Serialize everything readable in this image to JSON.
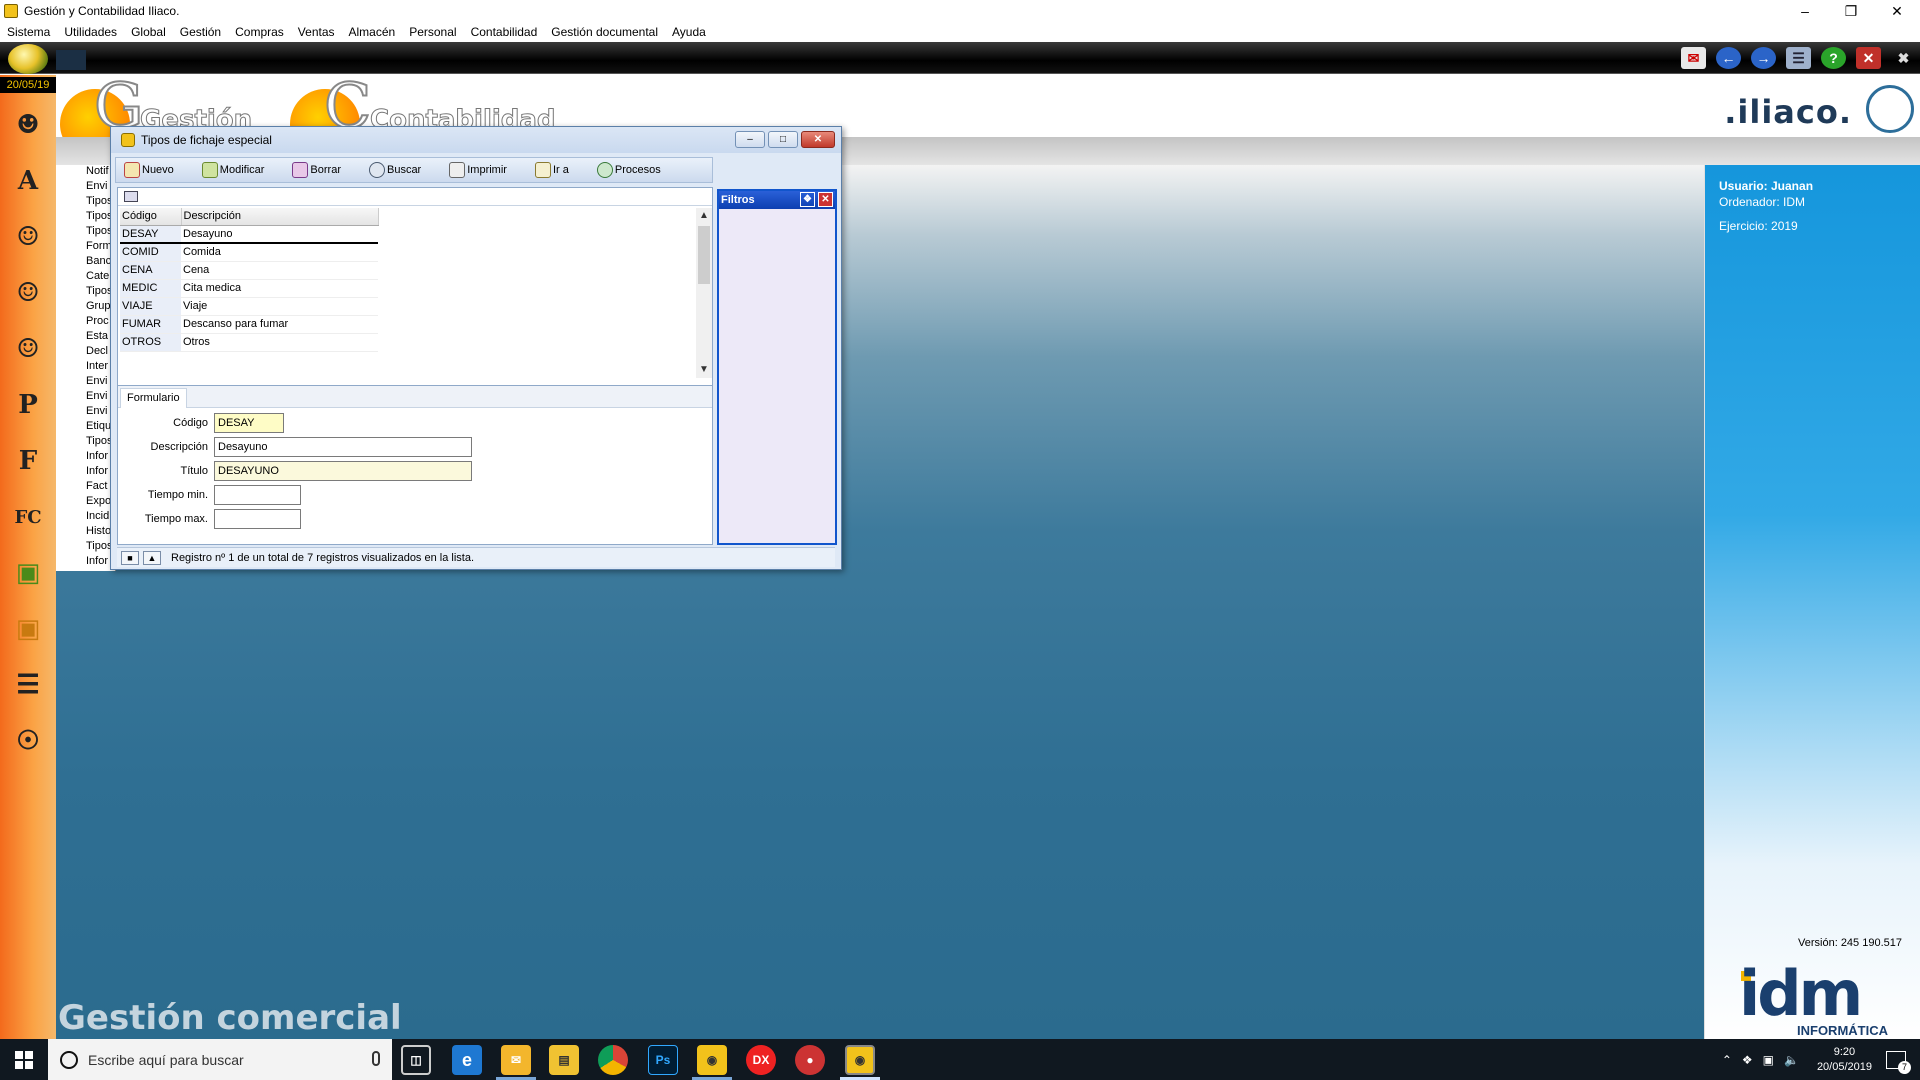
{
  "window": {
    "title": "Gestión y Contabilidad Iliaco."
  },
  "menu": [
    "Sistema",
    "Utilidades",
    "Global",
    "Gestión",
    "Compras",
    "Ventas",
    "Almacén",
    "Personal",
    "Contabilidad",
    "Gestión documental",
    "Ayuda"
  ],
  "sidebar": {
    "date": "20/05/19"
  },
  "header": {
    "brand": ".iliaco.",
    "word1": "Gestión",
    "word2": "Contabilidad"
  },
  "behind_list": [
    "Notif",
    "Envi",
    "Tipos",
    "Tipos",
    "Tipos",
    "Form",
    "Banc",
    "Cate",
    "Tipos",
    "Grup",
    "Proc",
    "Esta",
    "Decl",
    "Inter",
    "Envi",
    "Envi",
    "Envi",
    "Etiqu",
    "Tipos",
    "Infor",
    "Infor",
    "Fact",
    "Expo",
    "Incid",
    "Histo",
    "Tipos",
    "Infor"
  ],
  "dialog": {
    "title": "Tipos de fichaje especial",
    "toolbar": [
      "Nuevo",
      "Modificar",
      "Borrar",
      "Buscar",
      "Imprimir",
      "Ir a",
      "Procesos"
    ],
    "grid": {
      "columns": [
        "Código",
        "Descripción"
      ],
      "rows": [
        {
          "code": "DESAY",
          "desc": "Desayuno"
        },
        {
          "code": "COMID",
          "desc": "Comida"
        },
        {
          "code": "CENA",
          "desc": "Cena"
        },
        {
          "code": "MEDIC",
          "desc": "Cita medica"
        },
        {
          "code": "VIAJE",
          "desc": "Viaje"
        },
        {
          "code": "FUMAR",
          "desc": "Descanso para fumar"
        },
        {
          "code": "OTROS",
          "desc": "Otros"
        }
      ]
    },
    "form": {
      "tab": "Formulario",
      "fields": [
        {
          "label": "Código",
          "value": "DESAY"
        },
        {
          "label": "Descripción",
          "value": "Desayuno"
        },
        {
          "label": "Título",
          "value": "DESAYUNO"
        },
        {
          "label": "Tiempo min.",
          "value": ""
        },
        {
          "label": "Tiempo max.",
          "value": ""
        }
      ]
    },
    "status": "Registro nº 1 de un total de 7 registros visualizados en la lista.",
    "filtros": "Filtros"
  },
  "main": {
    "bottom_label": "Gestión comercial"
  },
  "right_panel": {
    "usuario": "Usuario: Juanan",
    "ordenador": "Ordenador: IDM",
    "ejercicio": "Ejercicio: 2019",
    "version": "Versión: 245 190.517",
    "logo": "idm",
    "logo_sub": "INFORMÁTICA"
  },
  "taskbar": {
    "search_placeholder": "Escribe aquí para buscar",
    "time": "9:20",
    "date": "20/05/2019",
    "notifications": "7"
  }
}
